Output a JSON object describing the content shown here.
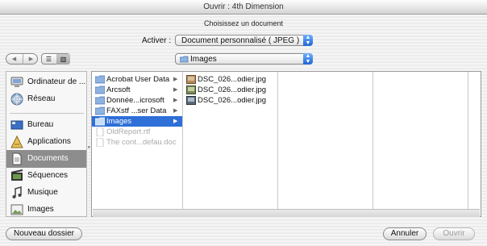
{
  "window": {
    "title": "Ouvrir : 4th Dimension"
  },
  "dialog": {
    "subtitle": "Choisissez un document"
  },
  "filter": {
    "label": "Activer :",
    "value": "Document personnalisé ( JPEG )"
  },
  "location": {
    "value": "Images"
  },
  "nav": {
    "back_icon": "back-arrow-icon",
    "forward_icon": "forward-arrow-icon",
    "list_view_icon": "list-view-icon",
    "column_view_icon": "column-view-icon"
  },
  "sidebar": {
    "items": [
      {
        "label": "Ordinateur de ...",
        "icon": "computer-icon"
      },
      {
        "label": "Réseau",
        "icon": "network-icon"
      },
      {
        "label": "Bureau",
        "icon": "desktop-icon"
      },
      {
        "label": "Applications",
        "icon": "applications-icon"
      },
      {
        "label": "Documents",
        "icon": "documents-icon",
        "selected": true
      },
      {
        "label": "Séquences",
        "icon": "movies-icon"
      },
      {
        "label": "Musique",
        "icon": "music-icon"
      },
      {
        "label": "Images",
        "icon": "pictures-icon"
      }
    ]
  },
  "columns": {
    "first": [
      {
        "label": "Acrobat User Data",
        "has_children": true
      },
      {
        "label": "Arcsoft",
        "has_children": true
      },
      {
        "label": "Donnée...icrosoft",
        "has_children": true
      },
      {
        "label": "FAXstf ...ser Data",
        "has_children": true
      },
      {
        "label": "Images",
        "has_children": true,
        "selected": true
      },
      {
        "label": "OldReport.rtf",
        "dimmed": true
      },
      {
        "label": "The cont...defau.doc",
        "dimmed": true
      }
    ],
    "second": [
      {
        "label": "DSC_026...odier.jpg"
      },
      {
        "label": "DSC_026...odier.jpg"
      },
      {
        "label": "DSC_026...odier.jpg"
      }
    ]
  },
  "buttons": {
    "new_folder": "Nouveau dossier",
    "cancel": "Annuler",
    "open": "Ouvrir"
  },
  "colors": {
    "selection": "#2e6fd8",
    "sidebar_selection": "#8d8d8d",
    "popup_arrow": "#1f65d6"
  }
}
